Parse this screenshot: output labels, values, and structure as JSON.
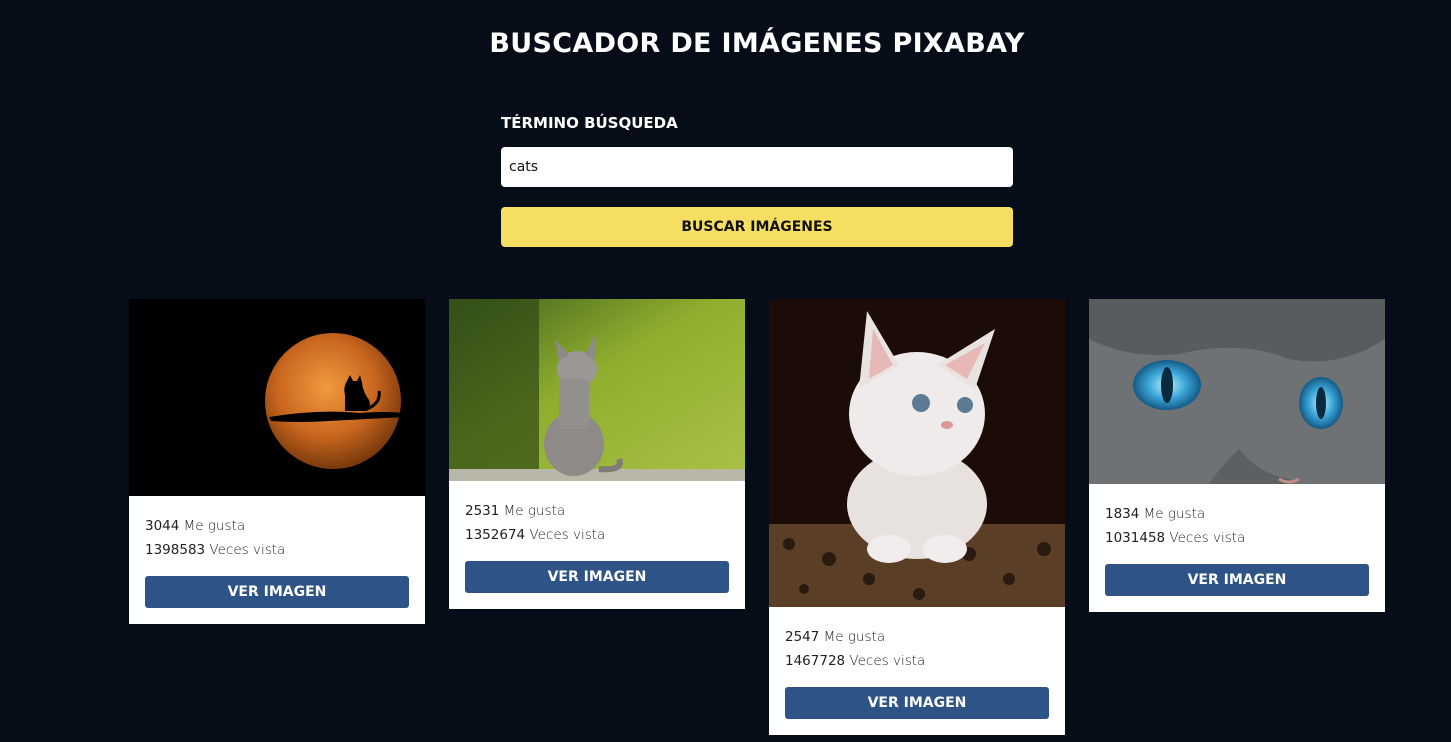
{
  "header": {
    "title": "BUSCADOR DE IMÁGENES PIXABAY"
  },
  "search": {
    "label": "TÉRMINO BÚSQUEDA",
    "value": "cats",
    "button_label": "BUSCAR IMÁGENES"
  },
  "results": [
    {
      "image": "moon-cat-silhouette",
      "likes": "3044",
      "likes_label": "Me gusta",
      "views": "1398583",
      "views_label": "Veces vista",
      "button_label": "VER IMAGEN"
    },
    {
      "image": "kitten-in-forest",
      "likes": "2531",
      "likes_label": "Me gusta",
      "views": "1352674",
      "views_label": "Veces vista",
      "button_label": "VER IMAGEN"
    },
    {
      "image": "white-kitten",
      "likes": "2547",
      "likes_label": "Me gusta",
      "views": "1467728",
      "views_label": "Veces vista",
      "button_label": "VER IMAGEN"
    },
    {
      "image": "blue-eyed-cat",
      "likes": "1834",
      "likes_label": "Me gusta",
      "views": "1031458",
      "views_label": "Veces vista",
      "button_label": "VER IMAGEN"
    }
  ],
  "colors": {
    "background": "#060d18",
    "search_button": "#f6de62",
    "card_button": "#2e5386"
  }
}
